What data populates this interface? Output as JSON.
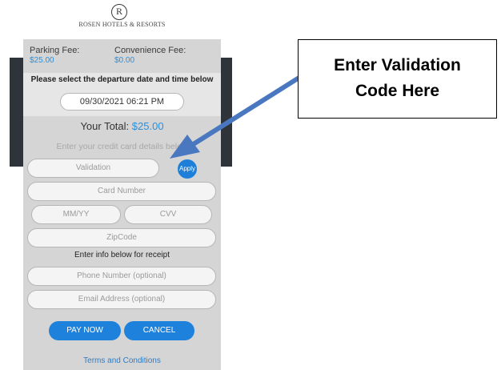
{
  "brand": {
    "logo_glyph": "R",
    "name": "ROSEN HOTELS & RESORTS"
  },
  "fees": {
    "parking_label": "Parking Fee:",
    "parking_value": "$25.00",
    "convenience_label": "Convenience Fee:",
    "convenience_value": "$0.00"
  },
  "departure": {
    "prompt": "Please select the departure date and time below",
    "datetime": "09/30/2021 06:21 PM"
  },
  "total": {
    "label": "Your Total:",
    "amount": "$25.00"
  },
  "credit_hint": "Enter your credit card details below",
  "form": {
    "validation_placeholder": "Validation",
    "apply_label": "Apply",
    "card_placeholder": "Card Number",
    "expiry_placeholder": "MM/YY",
    "cvv_placeholder": "CVV",
    "zip_placeholder": "ZipCode",
    "receipt_label": "Enter info below for receipt",
    "phone_placeholder": "Phone Number (optional)",
    "email_placeholder": "Email Address (optional)"
  },
  "buttons": {
    "pay": "PAY NOW",
    "cancel": "CANCEL"
  },
  "terms": "Terms and Conditions",
  "callout": {
    "line1": "Enter Validation",
    "line2": "Code Here"
  },
  "colors": {
    "accent": "#1e82dd",
    "arrow": "#4a78c0",
    "link": "#2f7cc5"
  }
}
